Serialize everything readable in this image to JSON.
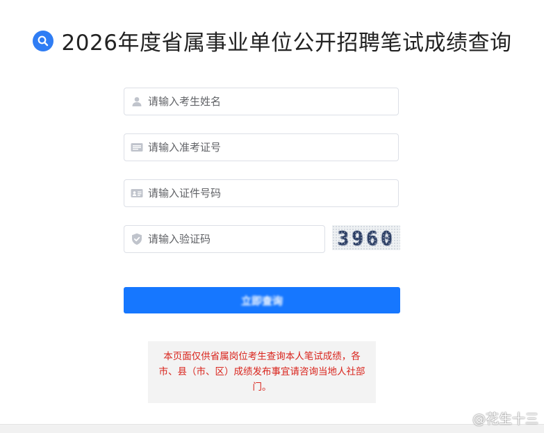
{
  "header": {
    "title": "2026年度省属事业单位公开招聘笔试成绩查询",
    "icon": "search-icon",
    "icon_color": "#2f7df4"
  },
  "form": {
    "name_placeholder": "请输入考生姓名",
    "ticket_placeholder": "请输入准考证号",
    "idcard_placeholder": "请输入证件号码",
    "captcha_placeholder": "请输入验证码",
    "captcha_code": "3960",
    "submit_label": "立即查询"
  },
  "notice": {
    "text": "本页面仅供省属岗位考生查询本人笔试成绩，各市、县（市、区）成绩发布事宜请咨询当地人社部门。",
    "color": "#d9241c"
  },
  "watermark": {
    "text": "@花生十三"
  },
  "colors": {
    "primary": "#1677ff",
    "border": "#dcdfe6"
  }
}
